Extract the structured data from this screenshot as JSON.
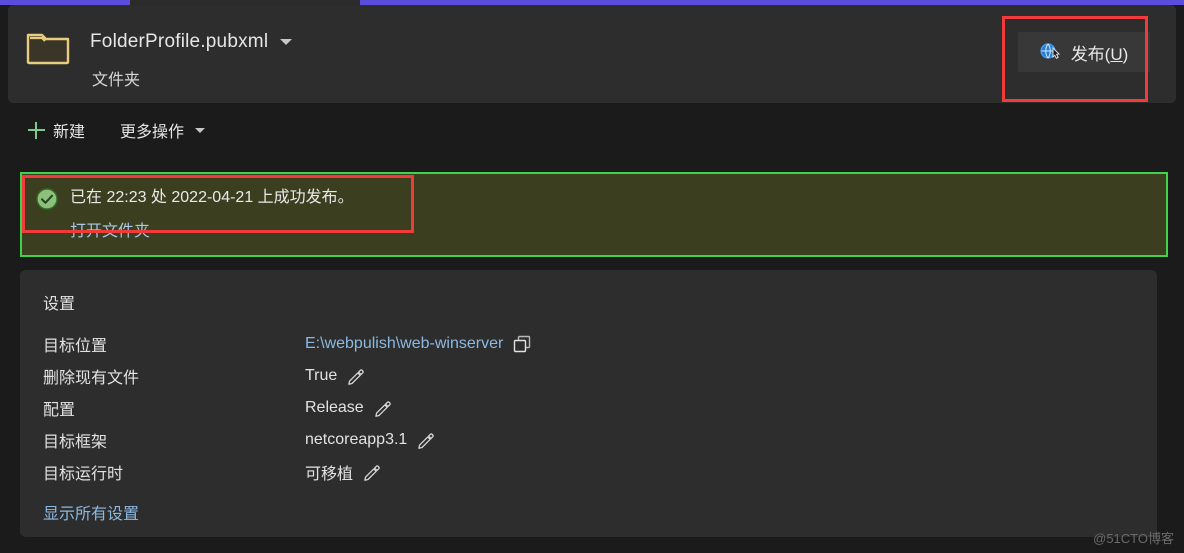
{
  "window": {
    "accent_color": "#5b4ddb",
    "background": "#1b1b1b"
  },
  "header": {
    "folder_icon": "folder-icon",
    "title": "FolderProfile.pubxml",
    "dropdown_icon": "chevron-down-icon",
    "subtitle": "文件夹",
    "publish_button": {
      "icon": "publish-globe-cursor-icon",
      "label_prefix": "发布(",
      "accel_key": "U",
      "label_suffix": ")"
    }
  },
  "toolbar": {
    "new_label": "新建",
    "new_icon": "plus-icon",
    "more_actions_label": "更多操作",
    "more_actions_icon": "chevron-down-icon"
  },
  "banner": {
    "status_icon": "success-check-icon",
    "message": "已在 22:23 处 2022-04-21 上成功发布。",
    "link_label": "打开文件夹",
    "border_color": "#3fd24a",
    "background_color": "#3c3f1f"
  },
  "settings": {
    "title": "设置",
    "rows": [
      {
        "label": "目标位置",
        "value": "E:\\webpulish\\web-winserver",
        "value_kind": "link",
        "action_icon": "copy-icon"
      },
      {
        "label": "删除现有文件",
        "value": "True",
        "value_kind": "text",
        "action_icon": "pencil-icon"
      },
      {
        "label": "配置",
        "value": "Release",
        "value_kind": "text",
        "action_icon": "pencil-icon"
      },
      {
        "label": "目标框架",
        "value": "netcoreapp3.1",
        "value_kind": "text",
        "action_icon": "pencil-icon"
      },
      {
        "label": "目标运行时",
        "value": "可移植",
        "value_kind": "text",
        "action_icon": "pencil-icon"
      }
    ],
    "show_all_label": "显示所有设置"
  },
  "annotations": {
    "publish_highlight_color": "#f03b3b",
    "banner_highlight_color": "#f03b3b"
  },
  "watermark": {
    "text": "@51CTO博客"
  }
}
